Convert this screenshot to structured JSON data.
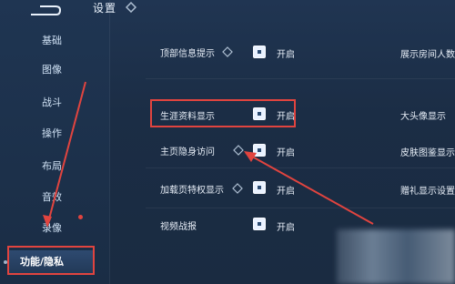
{
  "title": "设置",
  "sidebar": {
    "items": [
      {
        "label": "基础"
      },
      {
        "label": "图像"
      },
      {
        "label": "战斗"
      },
      {
        "label": "操作"
      },
      {
        "label": "布局"
      },
      {
        "label": "音效"
      },
      {
        "label": "录像"
      },
      {
        "label": "功能/隐私"
      }
    ]
  },
  "settings": {
    "rows": [
      {
        "label": "顶部信息提示",
        "state": "开启",
        "right": "展示房间人数"
      },
      {
        "label": "生涯资料显示",
        "state": "开启",
        "right": "大头像显示"
      },
      {
        "label": "主页隐身访问",
        "state": "开启",
        "right": "皮肤图鉴显示"
      },
      {
        "label": "加载页特权显示",
        "state": "开启",
        "right": "赠礼显示设置"
      },
      {
        "label": "视频战报",
        "state": "开启"
      }
    ]
  },
  "colors": {
    "annotation": "#e1443f",
    "toggle": "#eaf2ff",
    "background": "#1b2d45"
  }
}
